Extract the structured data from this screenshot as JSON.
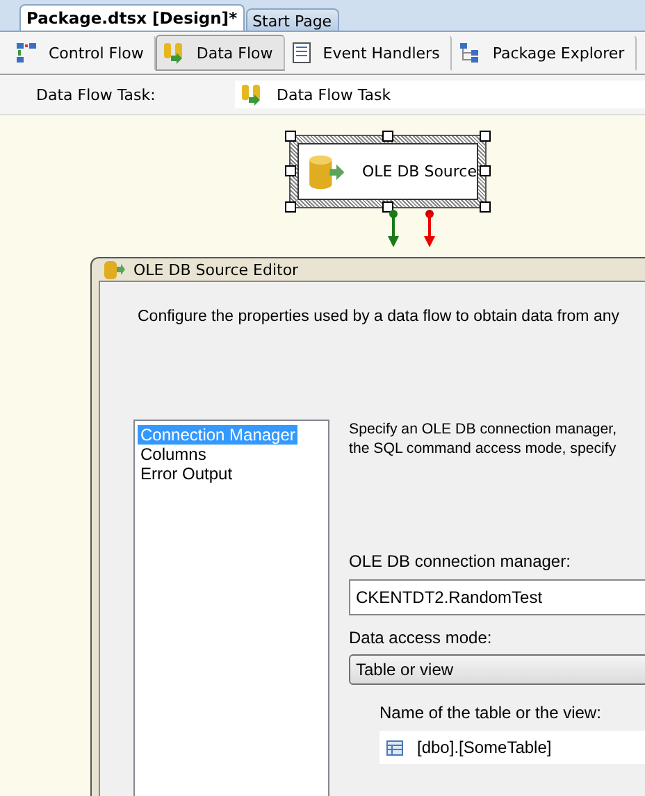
{
  "document_tabs": [
    {
      "label": "Package.dtsx [Design]*",
      "selected": true
    },
    {
      "label": "Start Page",
      "selected": false
    }
  ],
  "designer_tabs": [
    {
      "label": "Control Flow",
      "kind": "control",
      "selected": false
    },
    {
      "label": "Data Flow",
      "kind": "dataflow",
      "selected": true
    },
    {
      "label": "Event Handlers",
      "kind": "events",
      "selected": false
    },
    {
      "label": "Package Explorer",
      "kind": "explorer",
      "selected": false
    }
  ],
  "task": {
    "label": "Data Flow Task:",
    "value": "Data Flow Task"
  },
  "canvas": {
    "component": {
      "name": "OLE DB Source",
      "selected": true
    }
  },
  "dialog": {
    "title": "OLE DB Source Editor",
    "description": "Configure the properties used by a data flow to obtain data from any",
    "pages": [
      {
        "label": "Connection Manager",
        "selected": true
      },
      {
        "label": "Columns",
        "selected": false
      },
      {
        "label": "Error Output",
        "selected": false
      }
    ],
    "instructions": [
      "Specify an OLE DB connection manager,",
      "the SQL command access mode, specify"
    ],
    "connection_label": "OLE DB connection manager:",
    "connection_value": "CKENTDT2.RandomTest",
    "access_mode_label": "Data access mode:",
    "access_mode_value": "Table or view",
    "table_label": "Name of the table or the view:",
    "table_value": "[dbo].[SomeTable]"
  }
}
